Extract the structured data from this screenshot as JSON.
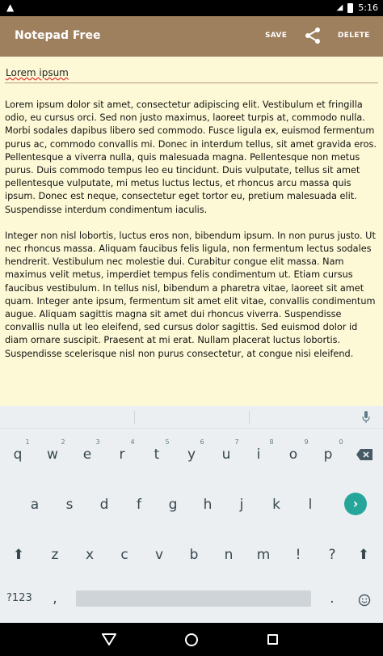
{
  "status_bar": {
    "time": "5:16"
  },
  "app_bar": {
    "title": "Notepad Free",
    "save_label": "SAVE",
    "delete_label": "DELETE"
  },
  "editor": {
    "title_value": "Lorem ipsum",
    "paragraph_1": "Lorem ipsum dolor sit amet, consectetur adipiscing elit. Vestibulum et fringilla odio, eu cursus orci. Sed non justo maximus, laoreet turpis at, commodo nulla. Morbi sodales dapibus libero sed commodo. Fusce ligula ex, euismod fermentum purus ac, commodo convallis mi. Donec in interdum tellus, sit amet gravida eros. Pellentesque a viverra nulla, quis malesuada magna. Pellentesque non metus purus. Duis commodo tempus leo eu tincidunt. Duis vulputate, tellus sit amet pellentesque vulputate, mi metus luctus lectus, et rhoncus arcu massa quis ipsum. Donec est neque, consectetur eget tortor eu, pretium malesuada elit. Suspendisse interdum condimentum iaculis.",
    "paragraph_2": "Integer non nisl lobortis, luctus eros non, bibendum ipsum. In non purus justo. Ut nec rhoncus massa. Aliquam faucibus felis ligula, non fermentum lectus sodales hendrerit. Vestibulum nec molestie dui. Curabitur congue elit massa. Nam maximus velit metus, imperdiet tempus felis condimentum ut. Etiam cursus faucibus vestibulum. In tellus nisl, bibendum a pharetra vitae, laoreet sit amet quam. Integer ante ipsum, fermentum sit amet elit vitae, convallis condimentum augue. Aliquam sagittis magna sit amet dui rhoncus viverra. Suspendisse convallis nulla ut leo eleifend, sed cursus dolor sagittis. Sed euismod dolor id diam ornare suscipit. Praesent at mi erat. Nullam placerat luctus lobortis. Suspendisse scelerisque nisl non purus consectetur, at congue nisi eleifend."
  },
  "keyboard": {
    "row1": [
      "q",
      "w",
      "e",
      "r",
      "t",
      "y",
      "u",
      "i",
      "o",
      "p"
    ],
    "row1_hints": [
      "1",
      "2",
      "3",
      "4",
      "5",
      "6",
      "7",
      "8",
      "9",
      "0"
    ],
    "row2": [
      "a",
      "s",
      "d",
      "f",
      "g",
      "h",
      "j",
      "k",
      "l"
    ],
    "row3": [
      "z",
      "x",
      "c",
      "v",
      "b",
      "n",
      "m",
      "!",
      "?"
    ],
    "symbols_label": "?123",
    "comma": ",",
    "period": ".",
    "go_glyph": "›",
    "shift_glyph": "⬆",
    "accent_color": "#26a69a"
  },
  "colors": {
    "app_bar": "#9e7f5e",
    "editor_bg": "#fdf9d6"
  }
}
